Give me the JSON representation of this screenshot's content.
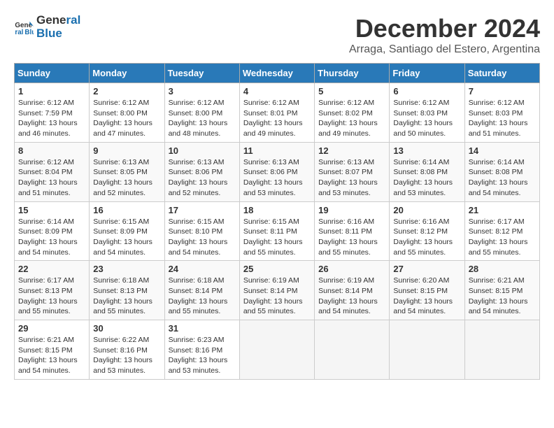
{
  "logo": {
    "line1": "General",
    "line2": "Blue"
  },
  "title": "December 2024",
  "location": "Arraga, Santiago del Estero, Argentina",
  "headers": [
    "Sunday",
    "Monday",
    "Tuesday",
    "Wednesday",
    "Thursday",
    "Friday",
    "Saturday"
  ],
  "weeks": [
    [
      {
        "day": "1",
        "sunrise": "6:12 AM",
        "sunset": "7:59 PM",
        "daylight": "13 hours and 46 minutes."
      },
      {
        "day": "2",
        "sunrise": "6:12 AM",
        "sunset": "8:00 PM",
        "daylight": "13 hours and 47 minutes."
      },
      {
        "day": "3",
        "sunrise": "6:12 AM",
        "sunset": "8:00 PM",
        "daylight": "13 hours and 48 minutes."
      },
      {
        "day": "4",
        "sunrise": "6:12 AM",
        "sunset": "8:01 PM",
        "daylight": "13 hours and 49 minutes."
      },
      {
        "day": "5",
        "sunrise": "6:12 AM",
        "sunset": "8:02 PM",
        "daylight": "13 hours and 49 minutes."
      },
      {
        "day": "6",
        "sunrise": "6:12 AM",
        "sunset": "8:03 PM",
        "daylight": "13 hours and 50 minutes."
      },
      {
        "day": "7",
        "sunrise": "6:12 AM",
        "sunset": "8:03 PM",
        "daylight": "13 hours and 51 minutes."
      }
    ],
    [
      {
        "day": "8",
        "sunrise": "6:12 AM",
        "sunset": "8:04 PM",
        "daylight": "13 hours and 51 minutes."
      },
      {
        "day": "9",
        "sunrise": "6:13 AM",
        "sunset": "8:05 PM",
        "daylight": "13 hours and 52 minutes."
      },
      {
        "day": "10",
        "sunrise": "6:13 AM",
        "sunset": "8:06 PM",
        "daylight": "13 hours and 52 minutes."
      },
      {
        "day": "11",
        "sunrise": "6:13 AM",
        "sunset": "8:06 PM",
        "daylight": "13 hours and 53 minutes."
      },
      {
        "day": "12",
        "sunrise": "6:13 AM",
        "sunset": "8:07 PM",
        "daylight": "13 hours and 53 minutes."
      },
      {
        "day": "13",
        "sunrise": "6:14 AM",
        "sunset": "8:08 PM",
        "daylight": "13 hours and 53 minutes."
      },
      {
        "day": "14",
        "sunrise": "6:14 AM",
        "sunset": "8:08 PM",
        "daylight": "13 hours and 54 minutes."
      }
    ],
    [
      {
        "day": "15",
        "sunrise": "6:14 AM",
        "sunset": "8:09 PM",
        "daylight": "13 hours and 54 minutes."
      },
      {
        "day": "16",
        "sunrise": "6:15 AM",
        "sunset": "8:09 PM",
        "daylight": "13 hours and 54 minutes."
      },
      {
        "day": "17",
        "sunrise": "6:15 AM",
        "sunset": "8:10 PM",
        "daylight": "13 hours and 54 minutes."
      },
      {
        "day": "18",
        "sunrise": "6:15 AM",
        "sunset": "8:11 PM",
        "daylight": "13 hours and 55 minutes."
      },
      {
        "day": "19",
        "sunrise": "6:16 AM",
        "sunset": "8:11 PM",
        "daylight": "13 hours and 55 minutes."
      },
      {
        "day": "20",
        "sunrise": "6:16 AM",
        "sunset": "8:12 PM",
        "daylight": "13 hours and 55 minutes."
      },
      {
        "day": "21",
        "sunrise": "6:17 AM",
        "sunset": "8:12 PM",
        "daylight": "13 hours and 55 minutes."
      }
    ],
    [
      {
        "day": "22",
        "sunrise": "6:17 AM",
        "sunset": "8:13 PM",
        "daylight": "13 hours and 55 minutes."
      },
      {
        "day": "23",
        "sunrise": "6:18 AM",
        "sunset": "8:13 PM",
        "daylight": "13 hours and 55 minutes."
      },
      {
        "day": "24",
        "sunrise": "6:18 AM",
        "sunset": "8:14 PM",
        "daylight": "13 hours and 55 minutes."
      },
      {
        "day": "25",
        "sunrise": "6:19 AM",
        "sunset": "8:14 PM",
        "daylight": "13 hours and 55 minutes."
      },
      {
        "day": "26",
        "sunrise": "6:19 AM",
        "sunset": "8:14 PM",
        "daylight": "13 hours and 54 minutes."
      },
      {
        "day": "27",
        "sunrise": "6:20 AM",
        "sunset": "8:15 PM",
        "daylight": "13 hours and 54 minutes."
      },
      {
        "day": "28",
        "sunrise": "6:21 AM",
        "sunset": "8:15 PM",
        "daylight": "13 hours and 54 minutes."
      }
    ],
    [
      {
        "day": "29",
        "sunrise": "6:21 AM",
        "sunset": "8:15 PM",
        "daylight": "13 hours and 54 minutes."
      },
      {
        "day": "30",
        "sunrise": "6:22 AM",
        "sunset": "8:16 PM",
        "daylight": "13 hours and 53 minutes."
      },
      {
        "day": "31",
        "sunrise": "6:23 AM",
        "sunset": "8:16 PM",
        "daylight": "13 hours and 53 minutes."
      },
      null,
      null,
      null,
      null
    ]
  ]
}
